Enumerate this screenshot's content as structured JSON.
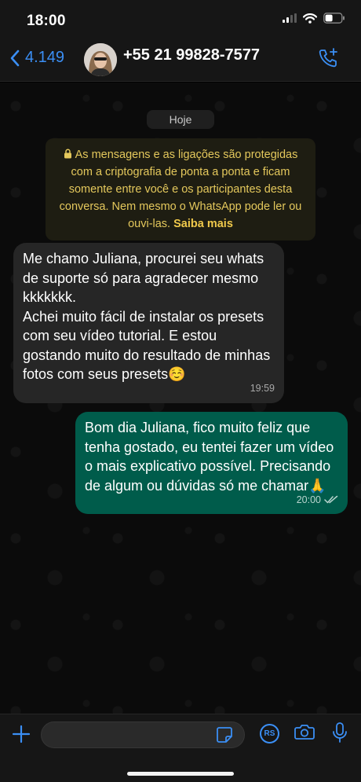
{
  "status_bar": {
    "time": "18:00"
  },
  "header": {
    "back_count": "4.149",
    "contact_name": "+55 21 99828-7577"
  },
  "chat": {
    "day_label": "Hoje",
    "encryption_notice": "As mensagens e as ligações são protegidas com a criptografia de ponta a ponta e ficam somente entre você e os participantes desta conversa. Nem mesmo o WhatsApp pode ler ou ouvi-las.",
    "encryption_link": "Saiba mais",
    "messages": [
      {
        "direction": "incoming",
        "text": "Me chamo Juliana, procurei seu whats de suporte só para agradecer mesmo kkkkkkk.\nAchei muito fácil de instalar os presets com seu vídeo tutorial. E estou gostando muito do resultado de minhas fotos com seus presets☺️",
        "time": "19:59"
      },
      {
        "direction": "outgoing",
        "text": "Bom dia Juliana, fico muito feliz que tenha gostado, eu tentei fazer um vídeo o mais explicativo possível. Precisando de algum ou dúvidas só me chamar🙏",
        "time": "20:00",
        "status": "read-checks-icon"
      }
    ]
  },
  "input_bar": {
    "text_value": "",
    "rs_label": "RS"
  },
  "colors": {
    "accent": "#3b8ff5",
    "incoming_bubble": "#262626",
    "outgoing_bubble": "#005c4b",
    "notice_text": "#e4c85c"
  }
}
